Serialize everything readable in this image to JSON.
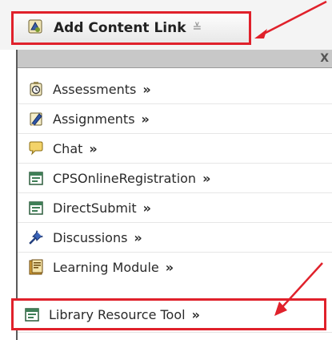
{
  "toolbar": {
    "add_content_link_label": "Add Content Link",
    "chevron_glyph": "≚"
  },
  "panel": {
    "close_glyph": "X",
    "items": [
      {
        "label": "Assessments",
        "icon": "assessment-icon",
        "arrow": "»"
      },
      {
        "label": "Assignments",
        "icon": "assignment-icon",
        "arrow": "»"
      },
      {
        "label": "Chat",
        "icon": "chat-icon",
        "arrow": "»"
      },
      {
        "label": "CPSOnlineRegistration",
        "icon": "registration-icon",
        "arrow": "»"
      },
      {
        "label": "DirectSubmit",
        "icon": "direct-submit-icon",
        "arrow": "»"
      },
      {
        "label": "Discussions",
        "icon": "discussions-pin-icon",
        "arrow": "»"
      },
      {
        "label": "Learning Module",
        "icon": "learning-module-icon",
        "arrow": "»"
      },
      {
        "label": "Library Resource Tool",
        "icon": "library-resource-icon",
        "arrow": "»"
      }
    ]
  },
  "colors": {
    "highlight_red": "#e0212b",
    "panel_header": "#c8c8c8"
  }
}
